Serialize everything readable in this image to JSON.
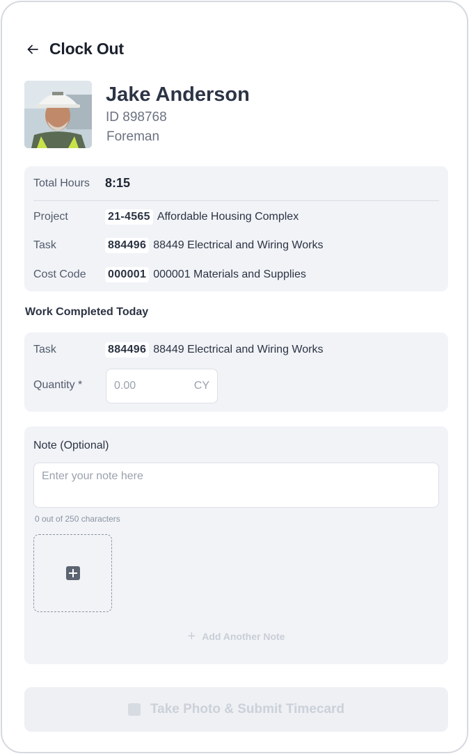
{
  "header": {
    "title": "Clock Out",
    "back_icon": "arrow-left-icon"
  },
  "employee": {
    "name": "Jake Anderson",
    "id_text": "ID 898768",
    "role": "Foreman",
    "avatar": "avatar-photo"
  },
  "summary": {
    "total_hours_label": "Total Hours",
    "total_hours_value": "8:15",
    "project_label": "Project",
    "project_code": "21-4565",
    "project_name": "Affordable Housing Complex",
    "task_label": "Task",
    "task_code": "884496",
    "task_name": "88449 Electrical and Wiring Works",
    "cost_code_label": "Cost Code",
    "cost_code": "000001",
    "cost_code_name": "000001 Materials and Supplies"
  },
  "work_completed": {
    "heading": "Work Completed Today",
    "task_label": "Task",
    "task_code": "884496",
    "task_name": "88449 Electrical and Wiring Works",
    "quantity_label": "Quantity *",
    "quantity_placeholder": "0.00",
    "quantity_unit": "CY"
  },
  "note": {
    "label": "Note (Optional)",
    "placeholder": "Enter your note here",
    "char_count": "0 out of 250 characters",
    "add_photo_icon": "plus-square-icon",
    "add_another_label": "Add Another Note"
  },
  "submit": {
    "label": "Take Photo & Submit Timecard",
    "icon": "camera-icon"
  },
  "colors": {
    "card_bg": "#f1f3f7",
    "text_primary": "#2b3342",
    "text_muted": "#6b7280",
    "disabled_text": "#ccd1d9"
  }
}
